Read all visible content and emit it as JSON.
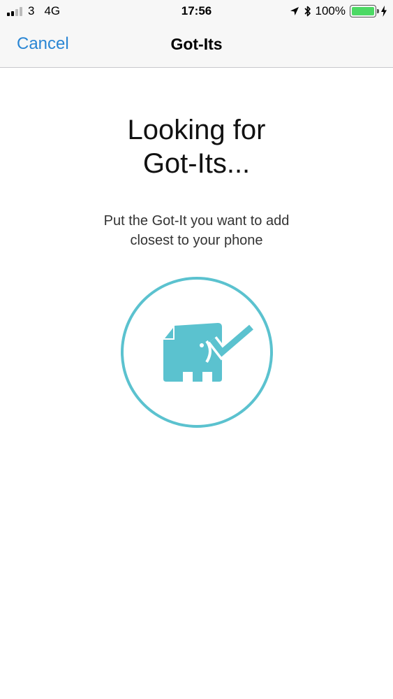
{
  "status_bar": {
    "carrier": "3",
    "network": "4G",
    "time": "17:56",
    "battery_percent": "100%",
    "battery_level": 1.0,
    "icons": [
      "signal-icon",
      "location-arrow-icon",
      "bluetooth-icon",
      "battery-icon",
      "charging-icon"
    ]
  },
  "nav": {
    "cancel_label": "Cancel",
    "title": "Got-Its"
  },
  "main": {
    "heading_line1": "Looking for",
    "heading_line2": "Got-Its...",
    "subtext_line1": "Put the Got-It you want to add",
    "subtext_line2": "closest to your phone",
    "icon": "elephant-tag-check-icon"
  },
  "colors": {
    "accent": "#2a86d4",
    "teal": "#5bc2cf",
    "battery": "#4cd964",
    "bar_background": "#f7f7f7"
  }
}
